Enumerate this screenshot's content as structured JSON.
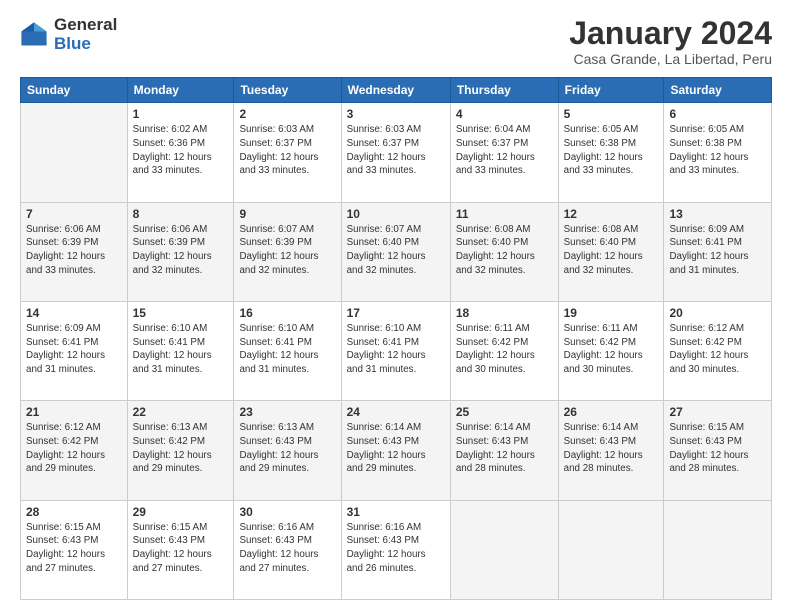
{
  "logo": {
    "general": "General",
    "blue": "Blue"
  },
  "title": "January 2024",
  "location": "Casa Grande, La Libertad, Peru",
  "days_of_week": [
    "Sunday",
    "Monday",
    "Tuesday",
    "Wednesday",
    "Thursday",
    "Friday",
    "Saturday"
  ],
  "weeks": [
    [
      {
        "num": "",
        "info": ""
      },
      {
        "num": "1",
        "info": "Sunrise: 6:02 AM\nSunset: 6:36 PM\nDaylight: 12 hours\nand 33 minutes."
      },
      {
        "num": "2",
        "info": "Sunrise: 6:03 AM\nSunset: 6:37 PM\nDaylight: 12 hours\nand 33 minutes."
      },
      {
        "num": "3",
        "info": "Sunrise: 6:03 AM\nSunset: 6:37 PM\nDaylight: 12 hours\nand 33 minutes."
      },
      {
        "num": "4",
        "info": "Sunrise: 6:04 AM\nSunset: 6:37 PM\nDaylight: 12 hours\nand 33 minutes."
      },
      {
        "num": "5",
        "info": "Sunrise: 6:05 AM\nSunset: 6:38 PM\nDaylight: 12 hours\nand 33 minutes."
      },
      {
        "num": "6",
        "info": "Sunrise: 6:05 AM\nSunset: 6:38 PM\nDaylight: 12 hours\nand 33 minutes."
      }
    ],
    [
      {
        "num": "7",
        "info": "Sunrise: 6:06 AM\nSunset: 6:39 PM\nDaylight: 12 hours\nand 33 minutes."
      },
      {
        "num": "8",
        "info": "Sunrise: 6:06 AM\nSunset: 6:39 PM\nDaylight: 12 hours\nand 32 minutes."
      },
      {
        "num": "9",
        "info": "Sunrise: 6:07 AM\nSunset: 6:39 PM\nDaylight: 12 hours\nand 32 minutes."
      },
      {
        "num": "10",
        "info": "Sunrise: 6:07 AM\nSunset: 6:40 PM\nDaylight: 12 hours\nand 32 minutes."
      },
      {
        "num": "11",
        "info": "Sunrise: 6:08 AM\nSunset: 6:40 PM\nDaylight: 12 hours\nand 32 minutes."
      },
      {
        "num": "12",
        "info": "Sunrise: 6:08 AM\nSunset: 6:40 PM\nDaylight: 12 hours\nand 32 minutes."
      },
      {
        "num": "13",
        "info": "Sunrise: 6:09 AM\nSunset: 6:41 PM\nDaylight: 12 hours\nand 31 minutes."
      }
    ],
    [
      {
        "num": "14",
        "info": "Sunrise: 6:09 AM\nSunset: 6:41 PM\nDaylight: 12 hours\nand 31 minutes."
      },
      {
        "num": "15",
        "info": "Sunrise: 6:10 AM\nSunset: 6:41 PM\nDaylight: 12 hours\nand 31 minutes."
      },
      {
        "num": "16",
        "info": "Sunrise: 6:10 AM\nSunset: 6:41 PM\nDaylight: 12 hours\nand 31 minutes."
      },
      {
        "num": "17",
        "info": "Sunrise: 6:10 AM\nSunset: 6:41 PM\nDaylight: 12 hours\nand 31 minutes."
      },
      {
        "num": "18",
        "info": "Sunrise: 6:11 AM\nSunset: 6:42 PM\nDaylight: 12 hours\nand 30 minutes."
      },
      {
        "num": "19",
        "info": "Sunrise: 6:11 AM\nSunset: 6:42 PM\nDaylight: 12 hours\nand 30 minutes."
      },
      {
        "num": "20",
        "info": "Sunrise: 6:12 AM\nSunset: 6:42 PM\nDaylight: 12 hours\nand 30 minutes."
      }
    ],
    [
      {
        "num": "21",
        "info": "Sunrise: 6:12 AM\nSunset: 6:42 PM\nDaylight: 12 hours\nand 29 minutes."
      },
      {
        "num": "22",
        "info": "Sunrise: 6:13 AM\nSunset: 6:42 PM\nDaylight: 12 hours\nand 29 minutes."
      },
      {
        "num": "23",
        "info": "Sunrise: 6:13 AM\nSunset: 6:43 PM\nDaylight: 12 hours\nand 29 minutes."
      },
      {
        "num": "24",
        "info": "Sunrise: 6:14 AM\nSunset: 6:43 PM\nDaylight: 12 hours\nand 29 minutes."
      },
      {
        "num": "25",
        "info": "Sunrise: 6:14 AM\nSunset: 6:43 PM\nDaylight: 12 hours\nand 28 minutes."
      },
      {
        "num": "26",
        "info": "Sunrise: 6:14 AM\nSunset: 6:43 PM\nDaylight: 12 hours\nand 28 minutes."
      },
      {
        "num": "27",
        "info": "Sunrise: 6:15 AM\nSunset: 6:43 PM\nDaylight: 12 hours\nand 28 minutes."
      }
    ],
    [
      {
        "num": "28",
        "info": "Sunrise: 6:15 AM\nSunset: 6:43 PM\nDaylight: 12 hours\nand 27 minutes."
      },
      {
        "num": "29",
        "info": "Sunrise: 6:15 AM\nSunset: 6:43 PM\nDaylight: 12 hours\nand 27 minutes."
      },
      {
        "num": "30",
        "info": "Sunrise: 6:16 AM\nSunset: 6:43 PM\nDaylight: 12 hours\nand 27 minutes."
      },
      {
        "num": "31",
        "info": "Sunrise: 6:16 AM\nSunset: 6:43 PM\nDaylight: 12 hours\nand 26 minutes."
      },
      {
        "num": "",
        "info": ""
      },
      {
        "num": "",
        "info": ""
      },
      {
        "num": "",
        "info": ""
      }
    ]
  ]
}
